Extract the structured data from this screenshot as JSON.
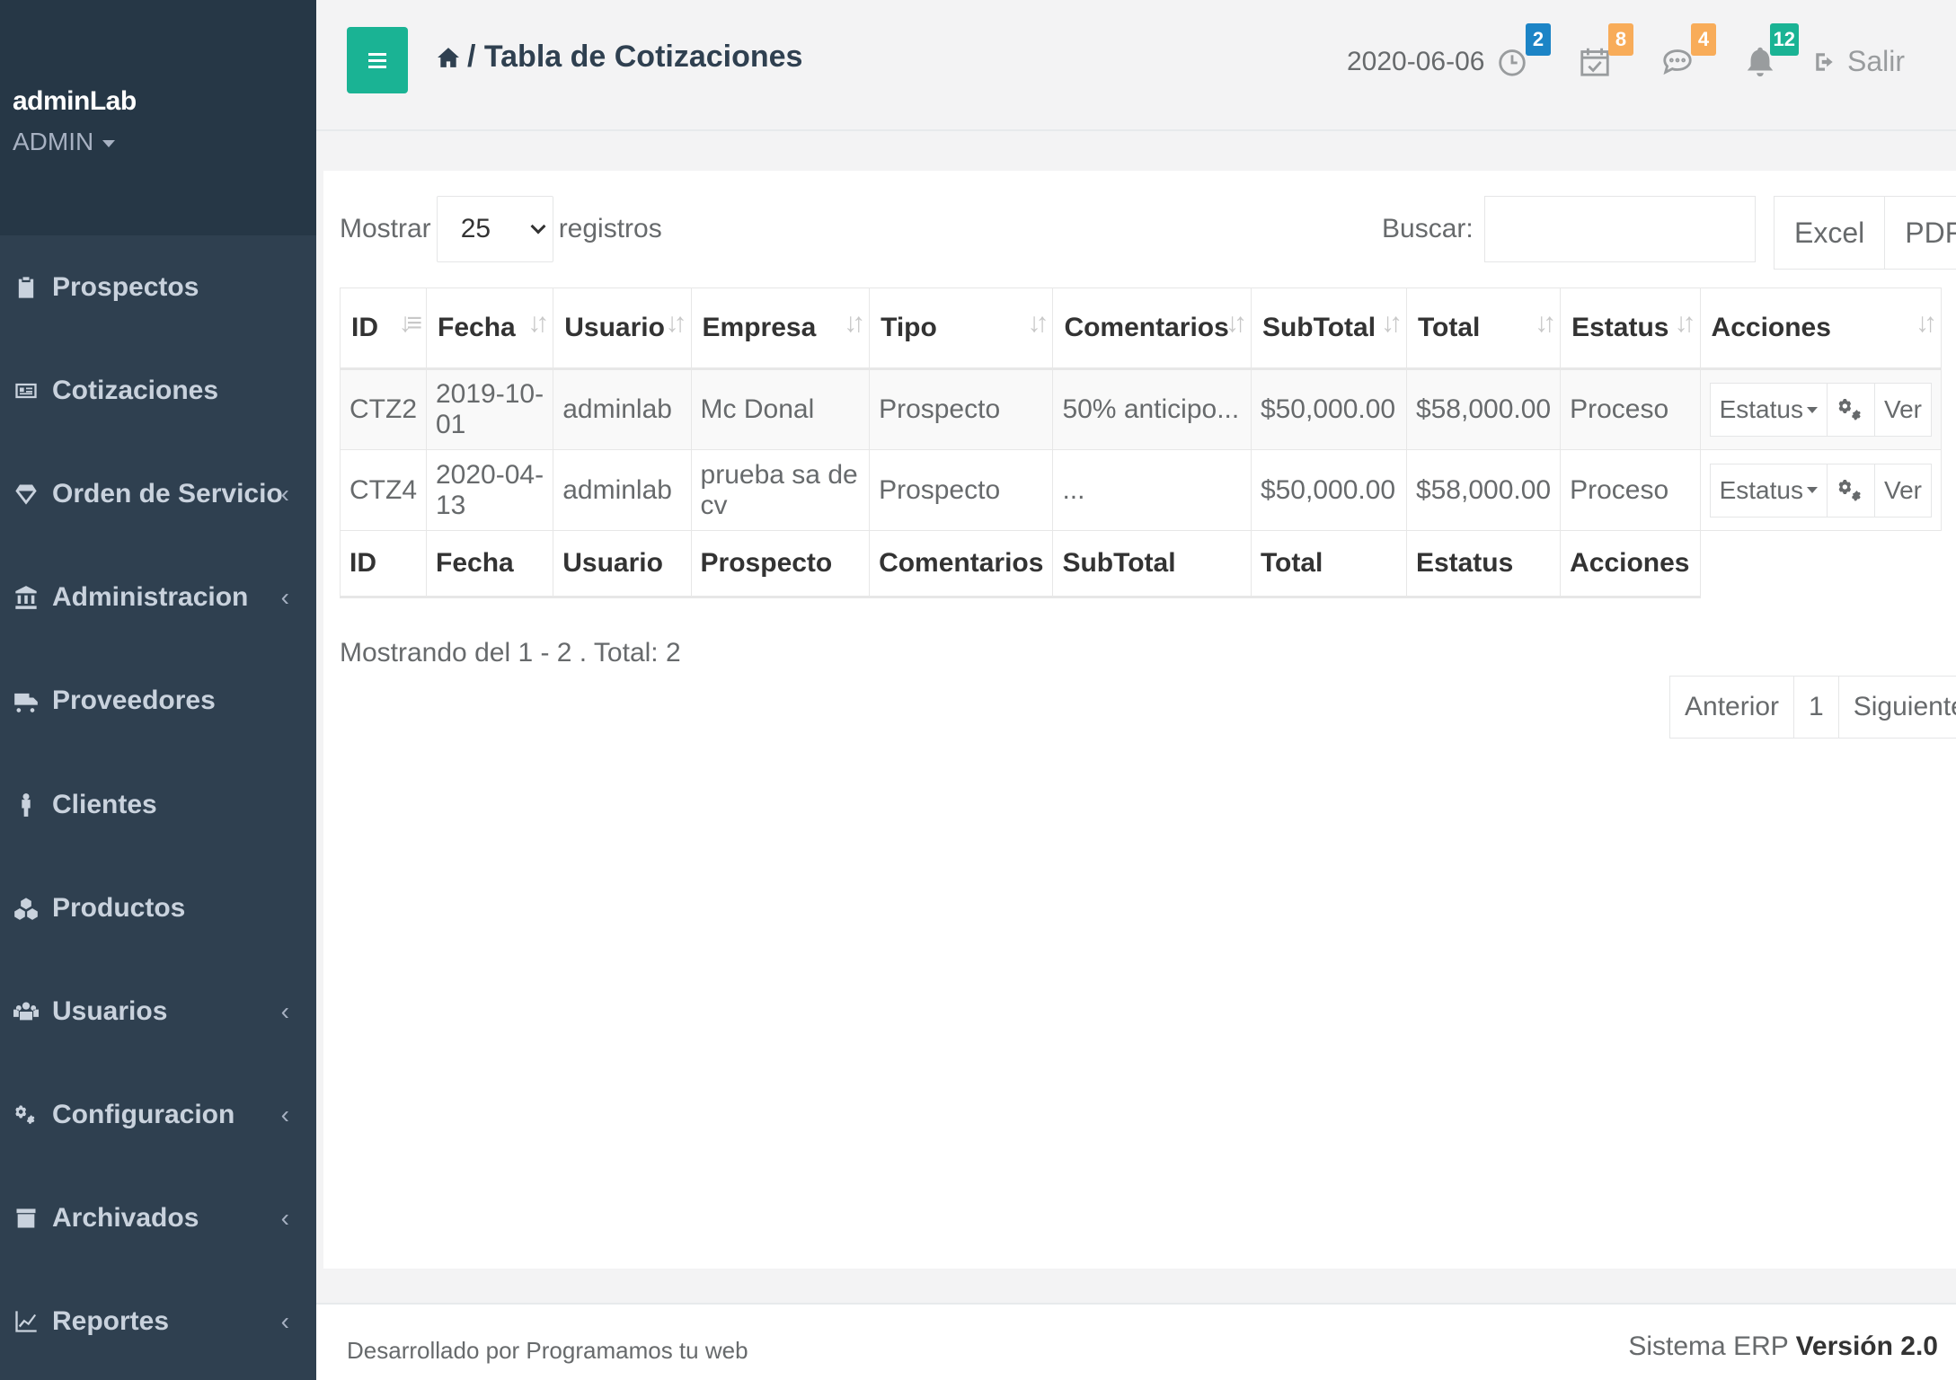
{
  "sidebar": {
    "user_name": "adminLab",
    "user_role": "ADMIN",
    "items": [
      {
        "label": "Prospectos",
        "icon": "clipboard-icon",
        "chevron": ""
      },
      {
        "label": "Cotizaciones",
        "icon": "id-card-icon",
        "chevron": ""
      },
      {
        "label": "Orden de Servicio",
        "icon": "diamond-icon",
        "chevron": "‹"
      },
      {
        "label": "Administracion",
        "icon": "bank-icon",
        "chevron": "‹"
      },
      {
        "label": "Proveedores",
        "icon": "truck-icon",
        "chevron": ""
      },
      {
        "label": "Clientes",
        "icon": "person-icon",
        "chevron": ""
      },
      {
        "label": "Productos",
        "icon": "cubes-icon",
        "chevron": ""
      },
      {
        "label": "Usuarios",
        "icon": "users-icon",
        "chevron": "‹"
      },
      {
        "label": "Configuracion",
        "icon": "cogs-icon",
        "chevron": "‹"
      },
      {
        "label": "Archivados",
        "icon": "archive-icon",
        "chevron": "‹"
      },
      {
        "label": "Reportes",
        "icon": "line-chart-icon",
        "chevron": "‹"
      }
    ]
  },
  "topbar": {
    "breadcrumb": "/ Tabla de Cotizaciones",
    "date": "2020-06-06",
    "badges": {
      "clock": {
        "count": "2",
        "color": "#1c84c6"
      },
      "calendar": {
        "count": "8",
        "color": "#f8ac59"
      },
      "chat": {
        "count": "4",
        "color": "#f8ac59"
      },
      "bell": {
        "count": "12",
        "color": "#1ab394"
      }
    },
    "logout_label": "Salir"
  },
  "controls": {
    "show_label": "Mostrar",
    "page_size": "25",
    "records_label": "registros",
    "search_label": "Buscar:",
    "search_value": "",
    "export_excel": "Excel",
    "export_pdf": "PDF"
  },
  "table": {
    "headers": [
      "ID",
      "Fecha",
      "Usuario",
      "Empresa",
      "Tipo",
      "Comentarios",
      "SubTotal",
      "Total",
      "Estatus",
      "Acciones"
    ],
    "rows": [
      {
        "id": "CTZ2",
        "fecha": "2019-10-01",
        "usuario": "adminlab",
        "empresa": "Mc Donal",
        "tipo": "Prospecto",
        "comentarios": "50% anticipo...",
        "subtotal": "$50,000.00",
        "total": "$58,000.00",
        "estatus": "Proceso"
      },
      {
        "id": "CTZ4",
        "fecha": "2020-04-13",
        "usuario": "adminlab",
        "empresa": "prueba sa de cv",
        "tipo": "Prospecto",
        "comentarios": "...",
        "subtotal": "$50,000.00",
        "total": "$58,000.00",
        "estatus": "Proceso"
      }
    ],
    "footers": [
      "ID",
      "Fecha",
      "Usuario",
      "Prospecto",
      "Comentarios",
      "SubTotal",
      "Total",
      "Estatus",
      "Acciones"
    ],
    "action_status": "Estatus",
    "action_view": "Ver"
  },
  "info": "Mostrando del 1 - 2 . Total: 2",
  "pagination": {
    "prev": "Anterior",
    "page": "1",
    "next": "Siguiente"
  },
  "footer": {
    "credit": "Desarrollado por Programamos tu web",
    "system": "Sistema ERP",
    "version": "Versión 2.0"
  }
}
